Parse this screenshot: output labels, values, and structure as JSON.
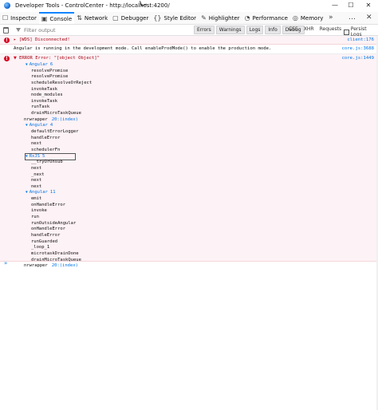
{
  "window": {
    "title": "Developer Tools - ControlCenter - http://localhost:4200/",
    "controls": {
      "minimize": "—",
      "maximize": "☐",
      "close": "✕"
    }
  },
  "toolbar": {
    "tabs": [
      {
        "label": "Inspector",
        "icon": "☐",
        "icon_name": "inspector-icon",
        "active": false
      },
      {
        "label": "Console",
        "icon": "▣",
        "icon_name": "console-icon",
        "active": true
      },
      {
        "label": "Network",
        "icon": "⇅",
        "icon_name": "network-icon",
        "active": false
      },
      {
        "label": "Debugger",
        "icon": "▢",
        "icon_name": "debugger-icon",
        "active": false
      },
      {
        "label": "Style Editor",
        "icon": "{}",
        "icon_name": "style-editor-icon",
        "active": false
      },
      {
        "label": "Highlighter",
        "icon": "✎",
        "icon_name": "highlighter-icon",
        "active": false
      },
      {
        "label": "Performance",
        "icon": "◔",
        "icon_name": "performance-icon",
        "active": false
      },
      {
        "label": "Memory",
        "icon": "◎",
        "icon_name": "memory-icon",
        "active": false
      }
    ],
    "more": "»",
    "menu": "…",
    "close": "✕"
  },
  "filterbar": {
    "placeholder": "Filter output",
    "pills": [
      "Errors",
      "Warnings",
      "Logs",
      "Info",
      "Debug"
    ],
    "plain": [
      "CSS",
      "XHR",
      "Requests"
    ],
    "persist_logs": "Persist Logs"
  },
  "console": {
    "wds": {
      "text": "▸ [WDS] Disconnected!",
      "location": "client:176"
    },
    "info": {
      "text": "Angular is running in the development mode. Call enableProdMode() to enable the production mode.",
      "location": "core.js:3688"
    },
    "error": {
      "header": "ERROR Error: \"[object Object]\"",
      "location": "core.js:1449",
      "groups": [
        {
          "label": "Angular",
          "count": "6",
          "frames": [
            "resolvePromise",
            "resolvePromise",
            "scheduleResolveOrReject",
            "invokeTask",
            "node_modules",
            "invokeTask",
            "runTask",
            "drainMicroTaskQueue"
          ]
        },
        {
          "tail_name": "nrwrapper",
          "tail_loc": "20:(index)"
        },
        {
          "label": "Angular",
          "count": "4",
          "frames": [
            "defaultErrorLogger",
            "handleError",
            "next",
            "schedulerFn"
          ]
        },
        {
          "label": "RxJS",
          "count": "5",
          "frames": [
            "__tryOrUnsub",
            "next",
            "_next",
            "next",
            "next"
          ]
        },
        {
          "label": "Angular",
          "count": "11",
          "frames": [
            "emit",
            "onHandleError",
            "invoke",
            "run",
            "runOutsideAngular",
            "onHandleError",
            "handleError",
            "runGuarded",
            "_loop_1",
            "microtaskDrainDone",
            "drainMicroTaskQueue"
          ]
        },
        {
          "tail_name": "nrwrapper",
          "tail_loc": "20:(index)"
        }
      ]
    },
    "prompt": "»"
  }
}
